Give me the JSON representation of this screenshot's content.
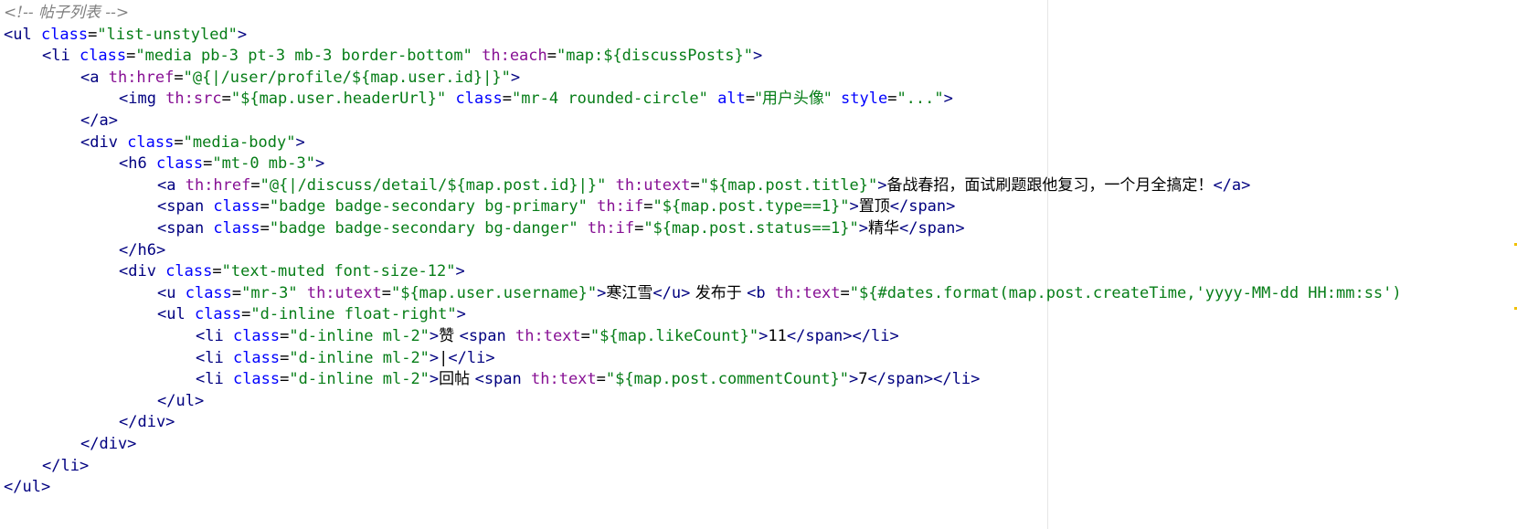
{
  "editor": {
    "lines": [
      {
        "indent": 0,
        "tokens": [
          {
            "t": "comment",
            "v": "<!-- 帖子列表 -->"
          }
        ]
      },
      {
        "indent": 0,
        "tokens": [
          {
            "t": "tag",
            "v": "<ul "
          },
          {
            "t": "attr",
            "v": "class"
          },
          {
            "t": "txt",
            "v": "="
          },
          {
            "t": "str",
            "v": "\"list-unstyled\""
          },
          {
            "t": "tag",
            "v": ">"
          }
        ]
      },
      {
        "indent": 1,
        "tokens": [
          {
            "t": "tag",
            "v": "<li "
          },
          {
            "t": "attr",
            "v": "class"
          },
          {
            "t": "txt",
            "v": "="
          },
          {
            "t": "str",
            "v": "\"media pb-3 pt-3 mb-3 border-bottom\""
          },
          {
            "t": "txt",
            "v": " "
          },
          {
            "t": "th",
            "v": "th:each"
          },
          {
            "t": "txt",
            "v": "="
          },
          {
            "t": "str",
            "v": "\"map:${discussPosts}\""
          },
          {
            "t": "tag",
            "v": ">"
          }
        ]
      },
      {
        "indent": 2,
        "tokens": [
          {
            "t": "tag",
            "v": "<a "
          },
          {
            "t": "th",
            "v": "th:href"
          },
          {
            "t": "txt",
            "v": "="
          },
          {
            "t": "str",
            "v": "\"@{|/user/profile/${map.user.id}|}\""
          },
          {
            "t": "tag",
            "v": ">"
          }
        ]
      },
      {
        "indent": 3,
        "tokens": [
          {
            "t": "tag",
            "v": "<img "
          },
          {
            "t": "th",
            "v": "th:src"
          },
          {
            "t": "txt",
            "v": "="
          },
          {
            "t": "str",
            "v": "\"${map.user.headerUrl}\""
          },
          {
            "t": "txt",
            "v": " "
          },
          {
            "t": "attr",
            "v": "class"
          },
          {
            "t": "txt",
            "v": "="
          },
          {
            "t": "str",
            "v": "\"mr-4 rounded-circle\""
          },
          {
            "t": "txt",
            "v": " "
          },
          {
            "t": "attr",
            "v": "alt"
          },
          {
            "t": "txt",
            "v": "="
          },
          {
            "t": "str",
            "v": "\"用户头像\""
          },
          {
            "t": "txt",
            "v": " "
          },
          {
            "t": "attr",
            "v": "style"
          },
          {
            "t": "txt",
            "v": "="
          },
          {
            "t": "str",
            "v": "\"...\""
          },
          {
            "t": "tag",
            "v": ">"
          }
        ]
      },
      {
        "indent": 2,
        "tokens": [
          {
            "t": "tag",
            "v": "</a>"
          }
        ]
      },
      {
        "indent": 2,
        "tokens": [
          {
            "t": "tag",
            "v": "<div "
          },
          {
            "t": "attr",
            "v": "class"
          },
          {
            "t": "txt",
            "v": "="
          },
          {
            "t": "str",
            "v": "\"media-body\""
          },
          {
            "t": "tag",
            "v": ">"
          }
        ]
      },
      {
        "indent": 3,
        "tokens": [
          {
            "t": "tag",
            "v": "<h6 "
          },
          {
            "t": "attr",
            "v": "class"
          },
          {
            "t": "txt",
            "v": "="
          },
          {
            "t": "str",
            "v": "\"mt-0 mb-3\""
          },
          {
            "t": "tag",
            "v": ">"
          }
        ]
      },
      {
        "indent": 4,
        "tokens": [
          {
            "t": "tag",
            "v": "<a "
          },
          {
            "t": "th",
            "v": "th:href"
          },
          {
            "t": "txt",
            "v": "="
          },
          {
            "t": "str",
            "v": "\"@{|/discuss/detail/${map.post.id}|}\""
          },
          {
            "t": "txt",
            "v": " "
          },
          {
            "t": "th",
            "v": "th:utext"
          },
          {
            "t": "txt",
            "v": "="
          },
          {
            "t": "str",
            "v": "\"${map.post.title}\""
          },
          {
            "t": "tag",
            "v": ">"
          },
          {
            "t": "txt",
            "v": "备战春招，面试刷题跟他复习，一个月全搞定！"
          },
          {
            "t": "tag",
            "v": "</a>"
          }
        ]
      },
      {
        "indent": 4,
        "tokens": [
          {
            "t": "tag",
            "v": "<span "
          },
          {
            "t": "attr",
            "v": "class"
          },
          {
            "t": "txt",
            "v": "="
          },
          {
            "t": "str",
            "v": "\"badge badge-secondary bg-primary\""
          },
          {
            "t": "txt",
            "v": " "
          },
          {
            "t": "th",
            "v": "th:if"
          },
          {
            "t": "txt",
            "v": "="
          },
          {
            "t": "str",
            "v": "\"${map.post.type==1}\""
          },
          {
            "t": "tag",
            "v": ">"
          },
          {
            "t": "txt",
            "v": "置顶"
          },
          {
            "t": "tag",
            "v": "</span>"
          }
        ]
      },
      {
        "indent": 4,
        "tokens": [
          {
            "t": "tag",
            "v": "<span "
          },
          {
            "t": "attr",
            "v": "class"
          },
          {
            "t": "txt",
            "v": "="
          },
          {
            "t": "str",
            "v": "\"badge badge-secondary bg-danger\""
          },
          {
            "t": "txt",
            "v": " "
          },
          {
            "t": "th",
            "v": "th:if"
          },
          {
            "t": "txt",
            "v": "="
          },
          {
            "t": "str",
            "v": "\"${map.post.status==1}\""
          },
          {
            "t": "tag",
            "v": ">"
          },
          {
            "t": "txt",
            "v": "精华"
          },
          {
            "t": "tag",
            "v": "</span>"
          }
        ]
      },
      {
        "indent": 3,
        "tokens": [
          {
            "t": "tag",
            "v": "</h6>"
          }
        ]
      },
      {
        "indent": 3,
        "tokens": [
          {
            "t": "tag",
            "v": "<div "
          },
          {
            "t": "attr",
            "v": "class"
          },
          {
            "t": "txt",
            "v": "="
          },
          {
            "t": "str",
            "v": "\"text-muted font-size-12\""
          },
          {
            "t": "tag",
            "v": ">"
          }
        ]
      },
      {
        "indent": 4,
        "tokens": [
          {
            "t": "tag",
            "v": "<u "
          },
          {
            "t": "attr",
            "v": "class"
          },
          {
            "t": "txt",
            "v": "="
          },
          {
            "t": "str",
            "v": "\"mr-3\""
          },
          {
            "t": "txt",
            "v": " "
          },
          {
            "t": "th",
            "v": "th:utext"
          },
          {
            "t": "txt",
            "v": "="
          },
          {
            "t": "str",
            "v": "\"${map.user.username}\""
          },
          {
            "t": "tag",
            "v": ">"
          },
          {
            "t": "txt",
            "v": "寒江雪"
          },
          {
            "t": "tag",
            "v": "</u>"
          },
          {
            "t": "txt",
            "v": " 发布于 "
          },
          {
            "t": "tag",
            "v": "<b "
          },
          {
            "t": "th",
            "v": "th:text"
          },
          {
            "t": "txt",
            "v": "="
          },
          {
            "t": "str",
            "v": "\"${#dates.format(map.post.createTime,'yyyy-MM-dd HH:mm:ss')"
          }
        ]
      },
      {
        "indent": 4,
        "tokens": [
          {
            "t": "tag",
            "v": "<ul "
          },
          {
            "t": "attr",
            "v": "class"
          },
          {
            "t": "txt",
            "v": "="
          },
          {
            "t": "str",
            "v": "\"d-inline float-right\""
          },
          {
            "t": "tag",
            "v": ">"
          }
        ]
      },
      {
        "indent": 5,
        "tokens": [
          {
            "t": "tag",
            "v": "<li "
          },
          {
            "t": "attr",
            "v": "class"
          },
          {
            "t": "txt",
            "v": "="
          },
          {
            "t": "str",
            "v": "\"d-inline ml-2\""
          },
          {
            "t": "tag",
            "v": ">"
          },
          {
            "t": "txt",
            "v": "赞 "
          },
          {
            "t": "tag",
            "v": "<span "
          },
          {
            "t": "th",
            "v": "th:text"
          },
          {
            "t": "txt",
            "v": "="
          },
          {
            "t": "str",
            "v": "\"${map.likeCount}\""
          },
          {
            "t": "tag",
            "v": ">"
          },
          {
            "t": "txt",
            "v": "11"
          },
          {
            "t": "tag",
            "v": "</span></li>"
          }
        ]
      },
      {
        "indent": 5,
        "tokens": [
          {
            "t": "tag",
            "v": "<li "
          },
          {
            "t": "attr",
            "v": "class"
          },
          {
            "t": "txt",
            "v": "="
          },
          {
            "t": "str",
            "v": "\"d-inline ml-2\""
          },
          {
            "t": "tag",
            "v": ">"
          },
          {
            "t": "txt",
            "v": "|"
          },
          {
            "t": "tag",
            "v": "</li>"
          }
        ]
      },
      {
        "indent": 5,
        "tokens": [
          {
            "t": "tag",
            "v": "<li "
          },
          {
            "t": "attr",
            "v": "class"
          },
          {
            "t": "txt",
            "v": "="
          },
          {
            "t": "str",
            "v": "\"d-inline ml-2\""
          },
          {
            "t": "tag",
            "v": ">"
          },
          {
            "t": "txt",
            "v": "回帖 "
          },
          {
            "t": "tag",
            "v": "<span "
          },
          {
            "t": "th",
            "v": "th:text"
          },
          {
            "t": "txt",
            "v": "="
          },
          {
            "t": "str",
            "v": "\"${map.post.commentCount}\""
          },
          {
            "t": "tag",
            "v": ">"
          },
          {
            "t": "txt",
            "v": "7"
          },
          {
            "t": "tag",
            "v": "</span></li>"
          }
        ]
      },
      {
        "indent": 4,
        "tokens": [
          {
            "t": "tag",
            "v": "</ul>"
          }
        ]
      },
      {
        "indent": 3,
        "tokens": [
          {
            "t": "tag",
            "v": "</div>"
          }
        ]
      },
      {
        "indent": 2,
        "tokens": [
          {
            "t": "tag",
            "v": "</div>"
          }
        ]
      },
      {
        "indent": 1,
        "tokens": [
          {
            "t": "tag",
            "v": "</li>"
          }
        ]
      },
      {
        "indent": 0,
        "tokens": [
          {
            "t": "tag",
            "v": "</ul>"
          }
        ]
      }
    ]
  },
  "colors": {
    "background": "#ffffff",
    "comment": "#808080",
    "tag": "#000080",
    "attribute": "#0000ff",
    "thymeleaf_attribute": "#871094",
    "string": "#067d17",
    "text": "#000000"
  }
}
